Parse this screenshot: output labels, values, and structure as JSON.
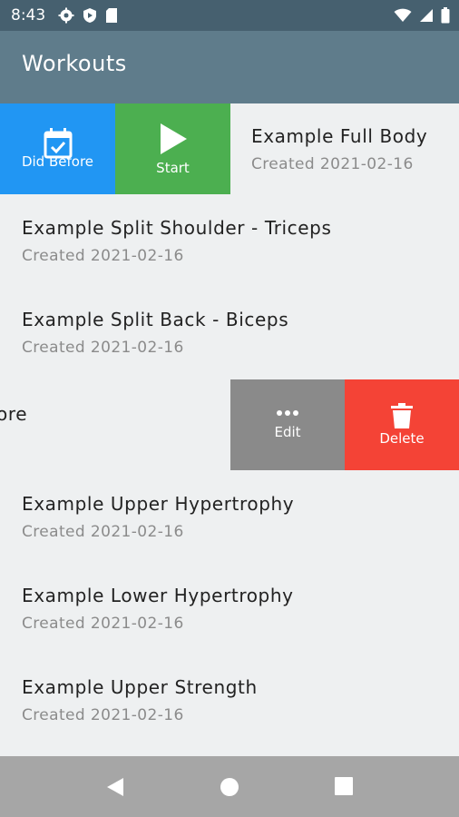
{
  "status": {
    "time": "8:43"
  },
  "app_bar": {
    "title": "Workouts"
  },
  "workouts": [
    {
      "title": "Example Full Body",
      "subtitle": "Created 2021-02-16"
    },
    {
      "title": "Example Split Shoulder - Triceps",
      "subtitle": "Created 2021-02-16"
    },
    {
      "title": "Example Split Back - Biceps",
      "subtitle": "Created 2021-02-16"
    },
    {
      "title": "ore",
      "subtitle": ""
    },
    {
      "title": "Example Upper Hypertrophy",
      "subtitle": "Created 2021-02-16"
    },
    {
      "title": "Example Lower Hypertrophy",
      "subtitle": "Created 2021-02-16"
    },
    {
      "title": "Example Upper Strength",
      "subtitle": "Created 2021-02-16"
    }
  ],
  "swipe_left_actions": {
    "did_before": "Did Before",
    "start": "Start"
  },
  "swipe_right_actions": {
    "edit": "Edit",
    "delete": "Delete"
  },
  "colors": {
    "did_before": "#2196f3",
    "start": "#4caf50",
    "edit": "#8a8a8a",
    "delete": "#f44336",
    "app_bar": "#5f7c8b",
    "status_bar": "#46606f"
  }
}
